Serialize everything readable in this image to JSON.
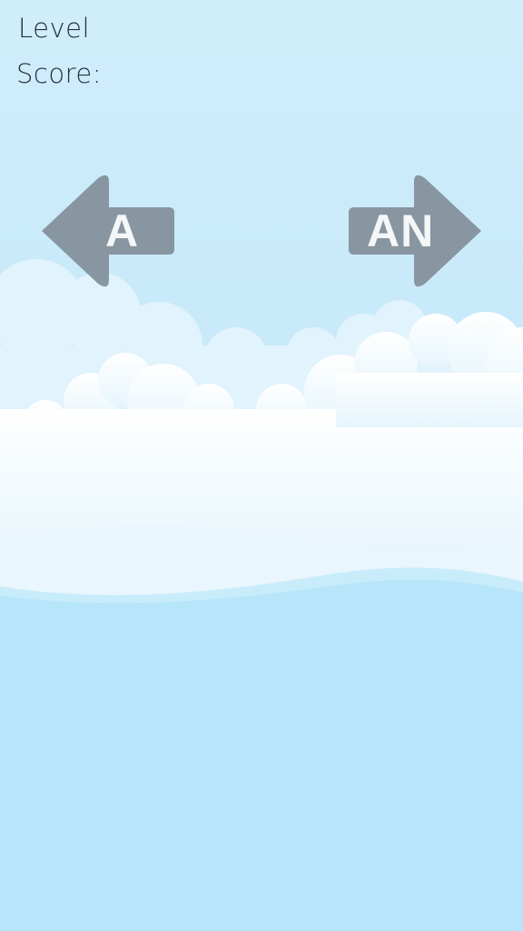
{
  "hud": {
    "level_label": "Level",
    "score_label": "Score:"
  },
  "buttons": {
    "left_answer": "A",
    "right_answer": "AN"
  },
  "colors": {
    "sky_top": "#d2eefa",
    "sky_lower": "#b7e6fa",
    "arrow_fill": "#7f8d96",
    "arrow_text": "#f4f6f8",
    "cloud_white": "#ffffff"
  }
}
